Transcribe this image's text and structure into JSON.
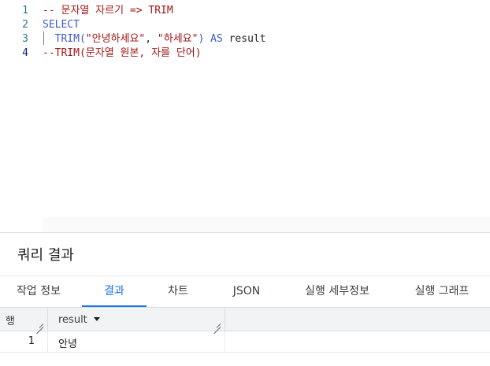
{
  "editor": {
    "line_numbers": [
      "1",
      "2",
      "3",
      "4"
    ],
    "lines": [
      {
        "comment": "-- 문자열 자르기 => TRIM"
      },
      {
        "keyword": "SELECT"
      },
      {
        "indent": "  ",
        "fn": "TRIM(",
        "str1": "\"안녕하세요\"",
        "sep": ", ",
        "str2": "\"하세요\"",
        "close": ")",
        "as_kw": " AS ",
        "alias": "result"
      },
      {
        "comment": "--TRIM(문자열 원본, 자를 단어)"
      }
    ],
    "active_line": 4
  },
  "results": {
    "title": "쿼리 결과",
    "tabs": [
      "작업 정보",
      "결과",
      "차트",
      "JSON",
      "실행 세부정보",
      "실행 그래프"
    ],
    "active_tab": "결과",
    "columns": {
      "row": "행",
      "result": "result"
    },
    "rows": [
      {
        "num": "1",
        "result": "안녕"
      }
    ]
  },
  "colors": {
    "accent": "#1a73e8",
    "keyword": "#3b5bcc",
    "string": "#a31515",
    "comment": "#a31515"
  }
}
